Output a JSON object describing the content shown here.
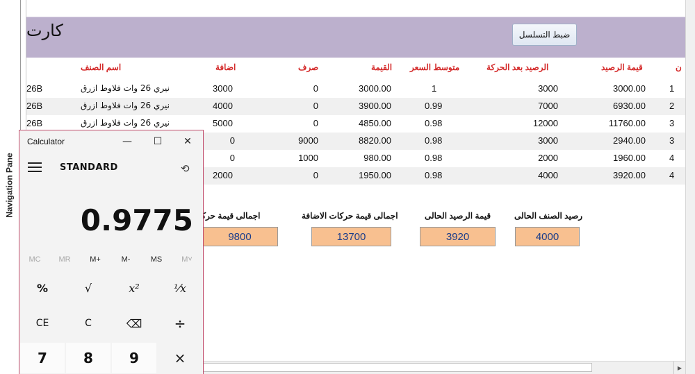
{
  "navigation_pane": {
    "label": "Navigation Pane"
  },
  "form": {
    "title": "كارت",
    "sort_button": "ضبط التسلسل",
    "columns": {
      "name": "اسم الصنف",
      "addition": "اضافة",
      "spend": "صرف",
      "value": "القيمة",
      "avg_price": "متوسط السعر",
      "balance_after": "الرصيد بعد الحركة",
      "balance_value": "قيمة الرصيد",
      "seq": "ن"
    },
    "rows": [
      {
        "code": "26B",
        "name": "نيري 26 وات فلاوط ازرق",
        "addition": "3000",
        "spend": "0",
        "value": "3000.00",
        "avg": "1",
        "balance_after": "3000",
        "balance_value": "3000.00",
        "seq": "1"
      },
      {
        "code": "26B",
        "name": "نيري 26 وات فلاوط ازرق",
        "addition": "4000",
        "spend": "0",
        "value": "3900.00",
        "avg": "0.99",
        "balance_after": "7000",
        "balance_value": "6930.00",
        "seq": "2"
      },
      {
        "code": "26B",
        "name": "نيري 26 وات فلاوط ازرق",
        "addition": "5000",
        "spend": "0",
        "value": "4850.00",
        "avg": "0.98",
        "balance_after": "12000",
        "balance_value": "11760.00",
        "seq": "3"
      },
      {
        "code": "",
        "name": "",
        "addition": "0",
        "spend": "9000",
        "value": "8820.00",
        "avg": "0.98",
        "balance_after": "3000",
        "balance_value": "2940.00",
        "seq": "3"
      },
      {
        "code": "",
        "name": "",
        "addition": "0",
        "spend": "1000",
        "value": "980.00",
        "avg": "0.98",
        "balance_after": "2000",
        "balance_value": "1960.00",
        "seq": "4"
      },
      {
        "code": "",
        "name": "",
        "addition": "2000",
        "spend": "0",
        "value": "1950.00",
        "avg": "0.98",
        "balance_after": "4000",
        "balance_value": "3920.00",
        "seq": "4"
      }
    ],
    "summary": {
      "total_movements_label": "اجمالى قيمة حركات ال",
      "total_movements_value": "9800",
      "total_additions_label": "اجمالى قيمة حركات الاضافة",
      "total_additions_value": "13700",
      "current_balance_value_label": "قيمة الرصيد الحالى",
      "current_balance_value": "3920",
      "current_item_balance_label": "رصيد الصنف الحالى",
      "current_item_balance": "4000"
    }
  },
  "calculator": {
    "title": "Calculator",
    "mode": "STANDARD",
    "display": "0.9775",
    "memory": [
      "MC",
      "MR",
      "M+",
      "M-",
      "MS",
      "M˅"
    ],
    "keys_row1": [
      "%",
      "√",
      "x²",
      "⅟x"
    ],
    "keys_row2": [
      "CE",
      "C",
      "⌫",
      "÷"
    ],
    "keys_row3": [
      "7",
      "8",
      "9",
      "×"
    ],
    "window_buttons": {
      "minimize": "—",
      "maximize": "☐",
      "close": "✕"
    },
    "icons": {
      "menu": "hamburger-icon",
      "history": "history-icon"
    }
  }
}
